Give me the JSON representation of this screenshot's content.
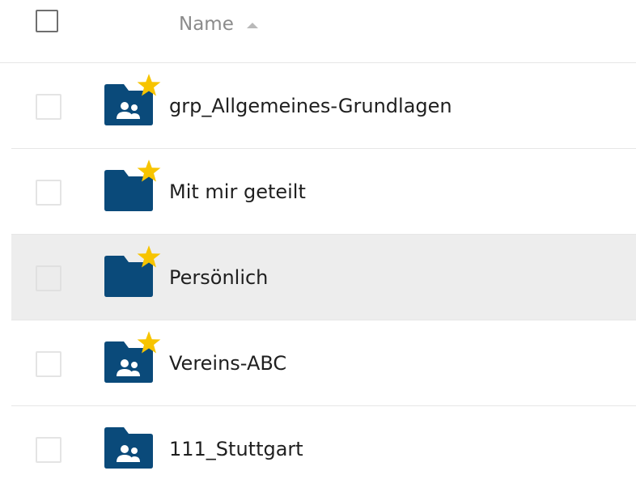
{
  "header": {
    "column_name_label": "Name",
    "sort_icon": "sort-ascending-icon"
  },
  "rows": [
    {
      "label": "grp_Allgemeines-Grundlagen",
      "icon": "group-folder-icon",
      "favorite": true
    },
    {
      "label": "Mit mir geteilt",
      "icon": "folder-icon",
      "favorite": true
    },
    {
      "label": "Persönlich",
      "icon": "folder-icon",
      "favorite": true,
      "hovered": true
    },
    {
      "label": "Vereins-ABC",
      "icon": "group-folder-icon",
      "favorite": true
    },
    {
      "label": "111_Stuttgart",
      "icon": "group-folder-icon",
      "favorite": false
    }
  ],
  "colors": {
    "folder": "#0a4a7a",
    "star": "#f7c400",
    "row_hover": "#ededed"
  }
}
